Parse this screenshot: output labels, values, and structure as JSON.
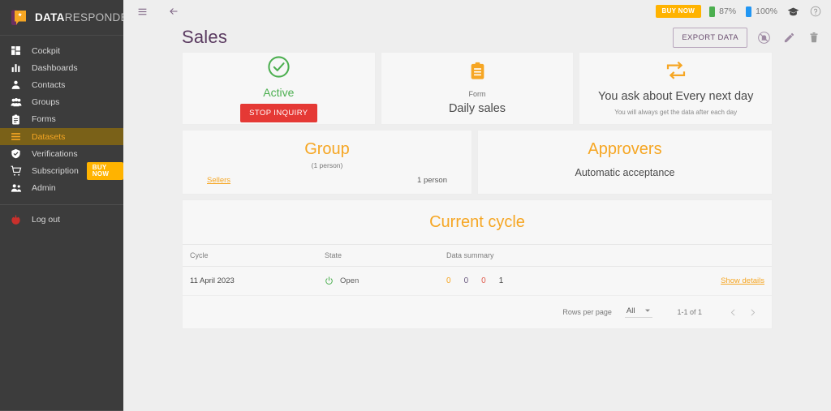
{
  "brand": {
    "name_bold": "DATA",
    "name_light": "RESPONDER",
    "logo_icon": "head-speech-bubble-star-logo"
  },
  "sidebar": {
    "items": [
      {
        "label": "Cockpit",
        "icon": "dashboard-grid-icon",
        "active": false
      },
      {
        "label": "Dashboards",
        "icon": "bar-chart-icon",
        "active": false
      },
      {
        "label": "Contacts",
        "icon": "person-icon",
        "active": false
      },
      {
        "label": "Groups",
        "icon": "people-group-icon",
        "active": false
      },
      {
        "label": "Forms",
        "icon": "clipboard-icon",
        "active": false
      },
      {
        "label": "Datasets",
        "icon": "list-lines-icon",
        "active": true
      },
      {
        "label": "Verifications",
        "icon": "shield-check-icon",
        "active": false
      },
      {
        "label": "Subscription",
        "icon": "shopping-cart-icon",
        "active": false,
        "badge": "BUY NOW"
      },
      {
        "label": "Admin",
        "icon": "people-admin-icon",
        "active": false
      }
    ],
    "logout": {
      "label": "Log out",
      "icon": "power-off-icon"
    }
  },
  "topbar": {
    "menu_icon": "hamburger-menu-icon",
    "back_icon": "arrow-left-icon",
    "buy_now": "BUY NOW",
    "meters": [
      {
        "value": "87%",
        "color": "#4caf50",
        "icon": "battery-green-icon"
      },
      {
        "value": "100%",
        "color": "#2196f3",
        "icon": "battery-blue-icon"
      }
    ],
    "graduation_icon": "graduation-cap-icon",
    "help_icon": "help-circle-icon"
  },
  "page": {
    "title": "Sales",
    "export_button": "EXPORT DATA",
    "actions": [
      {
        "name": "notifications-off-icon"
      },
      {
        "name": "edit-pencil-icon"
      },
      {
        "name": "delete-trash-icon"
      }
    ]
  },
  "cards": {
    "status": {
      "icon": "check-circle-icon",
      "label": "Active",
      "button": "STOP INQUIRY",
      "button_color": "#e53935",
      "label_color": "#4caf50"
    },
    "form": {
      "icon": "clipboard-form-icon",
      "sublabel": "Form",
      "value": "Daily sales"
    },
    "frequency": {
      "icon": "repeat-loop-icon",
      "title": "You ask about Every next day",
      "subtitle": "You will always get the data after each day"
    },
    "group": {
      "title": "Group",
      "subtitle": "(1 person)",
      "link": "Sellers",
      "count": "1 person"
    },
    "approvers": {
      "title": "Approvers",
      "subtitle": "Automatic acceptance"
    }
  },
  "cycle_panel": {
    "title": "Current cycle",
    "columns": [
      "Cycle",
      "State",
      "Data summary",
      ""
    ],
    "rows": [
      {
        "cycle": "11 April 2023",
        "state": "Open",
        "state_icon": "power-on-icon",
        "summary": [
          "0",
          "0",
          "0",
          "1"
        ],
        "action": "Show details"
      }
    ],
    "pager": {
      "rows_per_page_label": "Rows per page",
      "rows_per_page_value": "All",
      "dropdown_icon": "chevron-down-icon",
      "range": "1-1 of 1",
      "prev_icon": "chevron-left-icon",
      "next_icon": "chevron-right-icon"
    }
  },
  "colors": {
    "accent_orange": "#f6a623",
    "brand_purple": "#5a3a60",
    "sidebar_bg": "#3c3c3c",
    "active_item_bg": "#7a6118",
    "page_bg": "#eeeeee",
    "card_bg": "#f7f7f7"
  }
}
